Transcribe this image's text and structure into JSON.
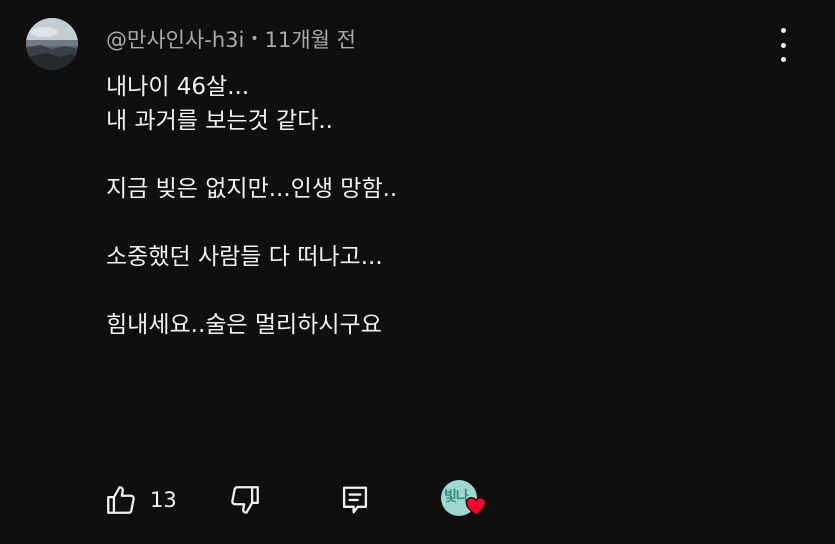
{
  "comment": {
    "author": "@만사인사-h3i",
    "separator": "•",
    "timestamp": "11개월 전",
    "lines": [
      "내나이 46살...",
      "내 과거를 보는것 같다..",
      "",
      "지금 빚은 없지만...인생 망함..",
      "",
      "소중했던 사람들 다 떠나고...",
      "",
      "힘내세요..술은 멀리하시구요"
    ],
    "likes": "13",
    "hearted_avatar_text": "빛나"
  },
  "icons": {
    "menu": "more-vertical-icon",
    "like": "thumbs-up-icon",
    "dislike": "thumbs-down-icon",
    "reply": "reply-icon",
    "heart": "heart-icon"
  },
  "colors": {
    "background": "#0f0f0f",
    "text": "#f1f1f1",
    "meta": "#aaaaaa",
    "heart": "#ff0033"
  }
}
